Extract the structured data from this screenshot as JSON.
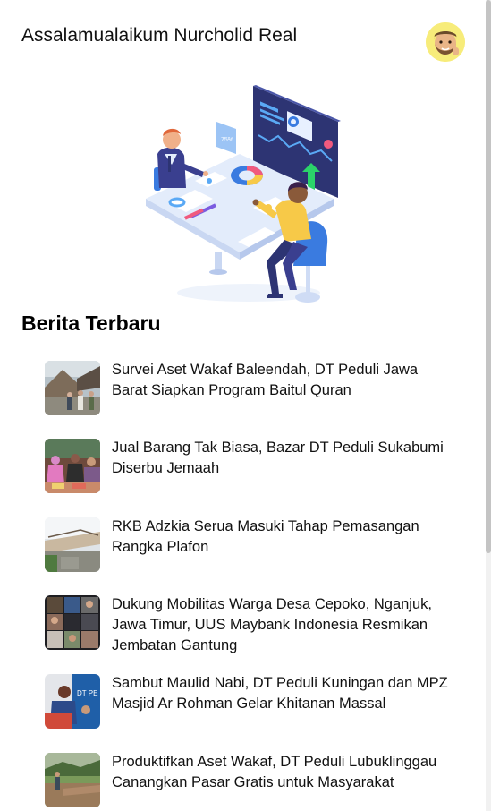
{
  "header": {
    "greeting": "Assalamualaikum Nurcholid Real",
    "avatar_icon": "memoji-avatar-icon"
  },
  "hero": {
    "illustration": "business-analytics-illustration"
  },
  "news": {
    "section_title": "Berita Terbaru",
    "items": [
      {
        "title": "Survei Aset Wakaf Baleendah, DT Peduli Jawa Barat Siapkan Program Baitul Quran"
      },
      {
        "title": "Jual Barang Tak Biasa, Bazar DT Peduli Sukabumi Diserbu Jemaah"
      },
      {
        "title": "RKB Adzkia Serua Masuki Tahap Pemasangan Rangka Plafon"
      },
      {
        "title": "Dukung Mobilitas Warga Desa Cepoko, Nganjuk, Jawa Timur, UUS Maybank Indonesia Resmikan Jembatan Gantung"
      },
      {
        "title": "Sambut Maulid Nabi, DT Peduli Kuningan dan MPZ Masjid Ar Rohman Gelar Khitanan Massal"
      },
      {
        "title": "Produktifkan Aset Wakaf, DT Peduli Lubuklinggau Canangkan Pasar Gratis untuk Masyarakat"
      }
    ]
  },
  "colors": {
    "accent_blue": "#3a7be0",
    "avatar_bg": "#f7ec7a",
    "text": "#111111"
  }
}
